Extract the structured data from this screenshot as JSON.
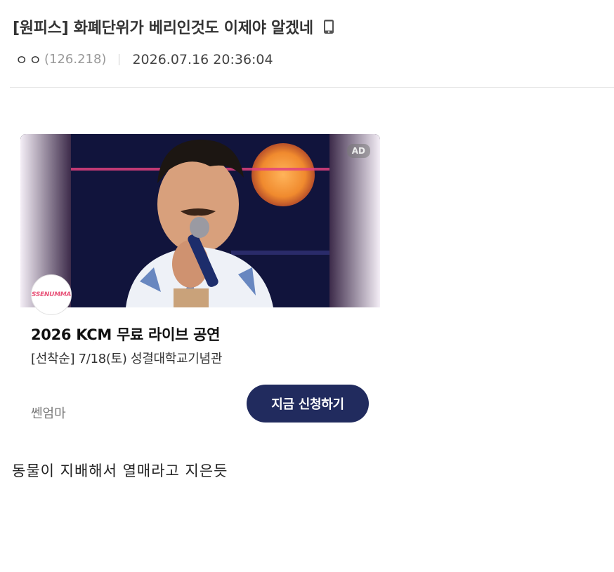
{
  "post": {
    "title": "[원피스] 화폐단위가 베리인것도 이제야 알겠네",
    "author": "ㅇㅇ",
    "ip": "(126.218)",
    "datetime": "2026.07.16 20:36:04",
    "body": "동물이 지배해서 열매라고 지은듯"
  },
  "icons": {
    "mobile": "mobile-phone-icon"
  },
  "ad": {
    "badge": "AD",
    "logo_text": "SSENUMMA",
    "title": "2026 KCM 무료 라이브 공연",
    "description": "[선착순] 7/18(토) 성결대학교기념관",
    "advertiser": "쎈엄마",
    "cta_label": "지금 신청하기"
  },
  "colors": {
    "cta_background": "#212b5e",
    "divider": "#e6e6e6",
    "ip_text": "#999999"
  }
}
